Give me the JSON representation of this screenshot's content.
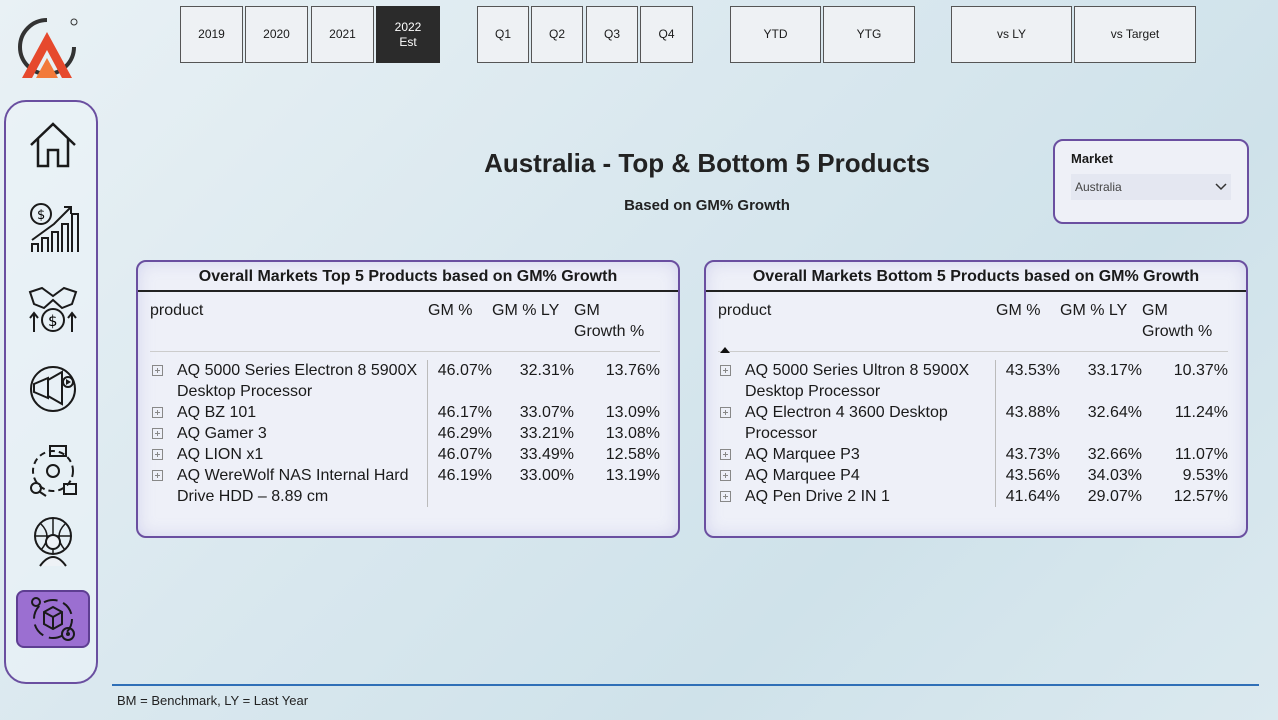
{
  "colors": {
    "accent": "#6a4fa0",
    "active_nav": "#9b6fd1",
    "selected_button": "#2b2b2b",
    "footer_rule": "#2f6fb7"
  },
  "sidebar": {
    "items": [
      {
        "icon": "home-icon"
      },
      {
        "icon": "finance-growth-icon"
      },
      {
        "icon": "sales-handshake-icon"
      },
      {
        "icon": "marketing-icon"
      },
      {
        "icon": "supply-chain-icon"
      },
      {
        "icon": "executive-globe-icon"
      },
      {
        "icon": "product-settings-icon",
        "active": true
      }
    ]
  },
  "filters": {
    "years": [
      {
        "label": "2019"
      },
      {
        "label": "2020"
      },
      {
        "label": "2021"
      },
      {
        "label": "2022",
        "sub": "Est",
        "selected": true
      }
    ],
    "quarters": [
      {
        "label": "Q1"
      },
      {
        "label": "Q2"
      },
      {
        "label": "Q3"
      },
      {
        "label": "Q4"
      }
    ],
    "periods": [
      {
        "label": "YTD"
      },
      {
        "label": "YTG"
      }
    ],
    "comparisons": [
      {
        "label": "vs LY"
      },
      {
        "label": "vs Target"
      }
    ]
  },
  "page": {
    "title": "Australia - Top & Bottom 5 Products",
    "subtitle": "Based on GM% Growth"
  },
  "market_slicer": {
    "label": "Market",
    "value": "Australia"
  },
  "top_table": {
    "title": "Overall Markets Top 5 Products based on GM% Growth",
    "headers": {
      "product": "product",
      "gm": "GM %",
      "gm_ly": "GM % LY",
      "growth_1": "GM",
      "growth_2": "Growth %"
    },
    "rows": [
      {
        "product": "AQ 5000 Series Electron 8 5900X Desktop Processor",
        "gm": "46.07%",
        "gm_ly": "32.31%",
        "growth": "13.76%"
      },
      {
        "product": "AQ BZ 101",
        "gm": "46.17%",
        "gm_ly": "33.07%",
        "growth": "13.09%"
      },
      {
        "product": "AQ Gamer 3",
        "gm": "46.29%",
        "gm_ly": "33.21%",
        "growth": "13.08%"
      },
      {
        "product": "AQ LION x1",
        "gm": "46.07%",
        "gm_ly": "33.49%",
        "growth": "12.58%"
      },
      {
        "product": "AQ WereWolf NAS Internal Hard Drive HDD – 8.89 cm",
        "gm": "46.19%",
        "gm_ly": "33.00%",
        "growth": "13.19%"
      }
    ]
  },
  "bottom_table": {
    "title": "Overall Markets Bottom 5 Products based on GM% Growth",
    "headers": {
      "product": "product",
      "gm": "GM %",
      "gm_ly": "GM % LY",
      "growth_1": "GM",
      "growth_2": "Growth %"
    },
    "rows": [
      {
        "product": "AQ 5000 Series Ultron 8 5900X Desktop Processor",
        "gm": "43.53%",
        "gm_ly": "33.17%",
        "growth": "10.37%"
      },
      {
        "product": "AQ Electron 4 3600 Desktop Processor",
        "gm": "43.88%",
        "gm_ly": "32.64%",
        "growth": "11.24%"
      },
      {
        "product": "AQ Marquee P3",
        "gm": "43.73%",
        "gm_ly": "32.66%",
        "growth": "11.07%"
      },
      {
        "product": "AQ Marquee P4",
        "gm": "43.56%",
        "gm_ly": "34.03%",
        "growth": "9.53%"
      },
      {
        "product": "AQ Pen Drive 2 IN 1",
        "gm": "41.64%",
        "gm_ly": "29.07%",
        "growth": "12.57%"
      }
    ]
  },
  "footer": {
    "note": "BM = Benchmark, LY = Last Year"
  }
}
